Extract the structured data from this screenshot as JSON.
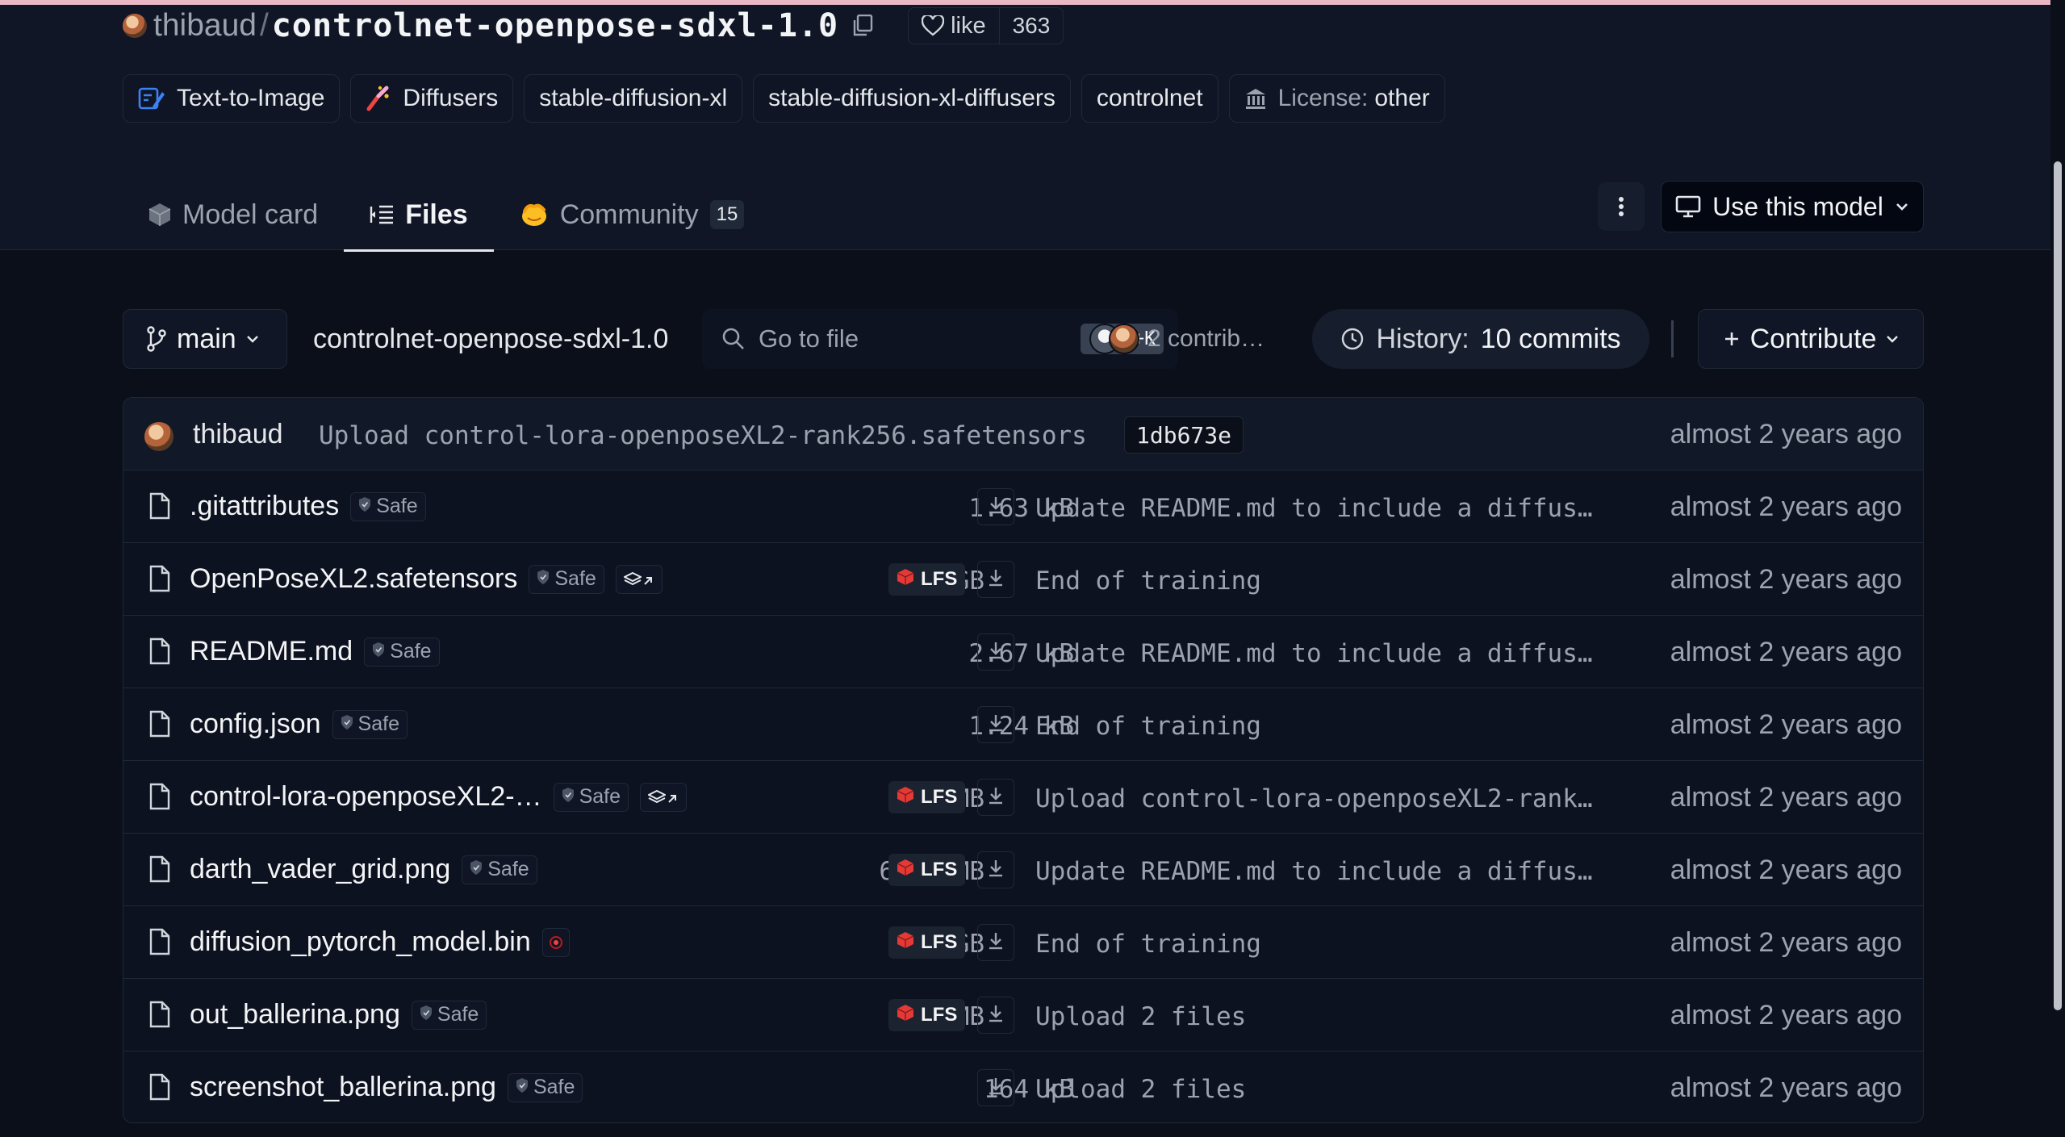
{
  "repo": {
    "owner": "thibaud",
    "separator": "/",
    "name": "controlnet-openpose-sdxl-1.0",
    "like_label": "like",
    "like_count": "363"
  },
  "tags": [
    {
      "label": "Text-to-Image",
      "icon": "text-to-image-icon"
    },
    {
      "label": "Diffusers",
      "icon": "diffusers-icon"
    },
    {
      "label": "stable-diffusion-xl"
    },
    {
      "label": "stable-diffusion-xl-diffusers"
    },
    {
      "label": "controlnet"
    },
    {
      "label_prefix": "License:",
      "label": "other",
      "icon": "license-icon"
    }
  ],
  "tabs": [
    {
      "label": "Model card",
      "icon": "cube-icon",
      "active": false
    },
    {
      "label": "Files",
      "icon": "files-icon",
      "active": true
    },
    {
      "label": "Community",
      "icon": "community-icon",
      "badge": "15",
      "active": false
    }
  ],
  "actions": {
    "use_model_label": "Use this model"
  },
  "branch_bar": {
    "branch": "main",
    "path": "controlnet-openpose-sdxl-1.0",
    "search_placeholder": "Go to file",
    "shortcut": "Ctrl+K",
    "contributors": "2 contrib…",
    "history_label": "History:",
    "history_value": "10 commits",
    "contribute_label": "Contribute"
  },
  "last_commit": {
    "author": "thibaud",
    "message": "Upload control-lora-openposeXL2-rank256.safetensors",
    "hash": "1db673e",
    "time": "almost 2 years ago"
  },
  "files": [
    {
      "name": ".gitattributes",
      "safe": "Safe",
      "size": "1.63 kB",
      "lfs": false,
      "message": "Update README.md to include a diffus…",
      "time": "almost 2 years ago"
    },
    {
      "name": "OpenPoseXL2.safetensors",
      "safe": "Safe",
      "stack": true,
      "size": "5 GB",
      "lfs": true,
      "message": "End of training",
      "time": "almost 2 years ago"
    },
    {
      "name": "README.md",
      "safe": "Safe",
      "size": "2.67 kB",
      "lfs": false,
      "message": "Update README.md to include a diffus…",
      "time": "almost 2 years ago"
    },
    {
      "name": "config.json",
      "safe": "Safe",
      "size": "1.24 kB",
      "lfs": false,
      "message": "End of training",
      "time": "almost 2 years ago"
    },
    {
      "name": "control-lora-openposeXL2-…",
      "safe": "Safe",
      "stack": true,
      "size": "774 MB",
      "lfs": true,
      "message": "Upload control-lora-openposeXL2-rank…",
      "time": "almost 2 years ago"
    },
    {
      "name": "darth_vader_grid.png",
      "safe": "Safe",
      "size": "6.62 MB",
      "lfs": true,
      "message": "Update README.md to include a diffus…",
      "time": "almost 2 years ago"
    },
    {
      "name": "diffusion_pytorch_model.bin",
      "scan": true,
      "size": "5 GB",
      "lfs": true,
      "message": "End of training",
      "time": "almost 2 years ago"
    },
    {
      "name": "out_ballerina.png",
      "safe": "Safe",
      "size": "1.1 MB",
      "lfs": true,
      "message": "Upload 2 files",
      "time": "almost 2 years ago"
    },
    {
      "name": "screenshot_ballerina.png",
      "safe": "Safe",
      "size": "164 kB",
      "lfs": false,
      "message": "Upload 2 files",
      "time": "almost 2 years ago"
    }
  ],
  "lfs_label": "LFS",
  "colors": {
    "background": "#0b0f19",
    "header": "#101625",
    "border": "#1f2937",
    "lfs_red": "#e53935",
    "community_yellow": "#fbbf24"
  }
}
